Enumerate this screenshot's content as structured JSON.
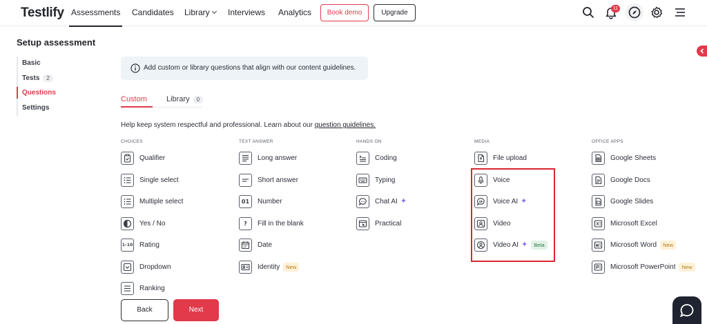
{
  "brand": {
    "logo": "Testlify",
    "accent": "#e23a4b"
  },
  "nav": {
    "items": [
      "Assessments",
      "Candidates",
      "Library",
      "Interviews",
      "Analytics"
    ],
    "book_demo": "Book demo",
    "upgrade": "Upgrade",
    "notifications_count": "11"
  },
  "page": {
    "title": "Setup assessment"
  },
  "sidebar": {
    "items": [
      {
        "label": "Basic",
        "count": ""
      },
      {
        "label": "Tests",
        "count": "2"
      },
      {
        "label": "Questions",
        "count": ""
      },
      {
        "label": "Settings",
        "count": ""
      }
    ],
    "active": "Questions"
  },
  "info": {
    "text": "Add custom or library questions that align with our content guidelines."
  },
  "tabs": {
    "custom": "Custom",
    "library": "Library",
    "library_count": "0"
  },
  "guidelines": {
    "text": "Help keep system respectful and professional. Learn about our",
    "link": "question guidelines."
  },
  "categories": {
    "choices": {
      "heading": "CHOICES",
      "items": [
        {
          "label": "Qualifier",
          "icon": "clipboard-check-icon"
        },
        {
          "label": "Single select",
          "icon": "list-icon"
        },
        {
          "label": "Multiple select",
          "icon": "list-icon"
        },
        {
          "label": "Yes / No",
          "icon": "half-circle-icon"
        },
        {
          "label": "Rating",
          "icon": "rating-icon",
          "glyph": "1–10"
        },
        {
          "label": "Dropdown",
          "icon": "dropdown-icon"
        },
        {
          "label": "Ranking",
          "icon": "ranking-icon"
        }
      ]
    },
    "text_answer": {
      "heading": "TEXT ANSWER",
      "items": [
        {
          "label": "Long answer",
          "icon": "long-text-icon"
        },
        {
          "label": "Short answer",
          "icon": "short-text-icon"
        },
        {
          "label": "Number",
          "icon": "number-icon",
          "glyph": "01"
        },
        {
          "label": "Fill in the blank",
          "icon": "question-mark-icon",
          "glyph": "?"
        },
        {
          "label": "Date",
          "icon": "calendar-icon"
        },
        {
          "label": "Identity",
          "icon": "id-card-icon",
          "tag": "New"
        }
      ]
    },
    "hands_on": {
      "heading": "HANDS ON",
      "items": [
        {
          "label": "Coding",
          "icon": "code-icon"
        },
        {
          "label": "Typing",
          "icon": "keyboard-icon"
        },
        {
          "label": "Chat AI",
          "icon": "chat-icon",
          "sparkle": "✦"
        },
        {
          "label": "Practical",
          "icon": "practical-icon"
        }
      ]
    },
    "media": {
      "heading": "MEDIA",
      "items": [
        {
          "label": "File upload",
          "icon": "file-icon"
        },
        {
          "label": "Voice",
          "icon": "microphone-icon"
        },
        {
          "label": "Voice AI",
          "icon": "voice-ai-icon",
          "sparkle": "✦"
        },
        {
          "label": "Video",
          "icon": "video-user-icon"
        },
        {
          "label": "Video AI",
          "icon": "video-ai-icon",
          "sparkle": "✦",
          "tag": "Beta"
        }
      ]
    },
    "office_apps": {
      "heading": "OFFICE APPS",
      "items": [
        {
          "label": "Google Sheets",
          "icon": "sheets-icon"
        },
        {
          "label": "Google Docs",
          "icon": "docs-icon"
        },
        {
          "label": "Google Slides",
          "icon": "slides-icon"
        },
        {
          "label": "Microsoft Excel",
          "icon": "excel-icon"
        },
        {
          "label": "Microsoft Word",
          "icon": "word-icon",
          "tag": "New"
        },
        {
          "label": "Microsoft PowerPoint",
          "icon": "powerpoint-icon",
          "tag": "New"
        }
      ]
    }
  },
  "footer": {
    "back": "Back",
    "next": "Next"
  }
}
